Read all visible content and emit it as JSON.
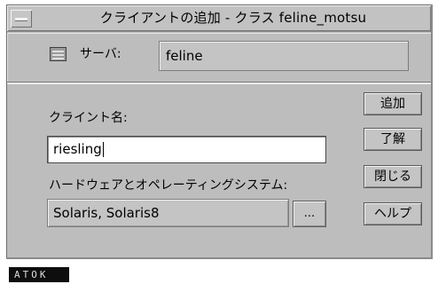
{
  "window": {
    "title": "クライアントの追加 - クラス feline_motsu"
  },
  "server": {
    "label": "サーバ:",
    "value": "feline",
    "icon": "server-icon"
  },
  "form": {
    "client_label": "クライント名:",
    "client_value": "riesling",
    "os_label": "ハードウェアとオペレーティングシステム:",
    "os_value": "Solaris, Solaris8",
    "browse_label": "..."
  },
  "buttons": {
    "add": "追加",
    "ok": "了解",
    "close": "閉じる",
    "help": "ヘルプ"
  },
  "taskbar": {
    "text": "ATOK"
  }
}
